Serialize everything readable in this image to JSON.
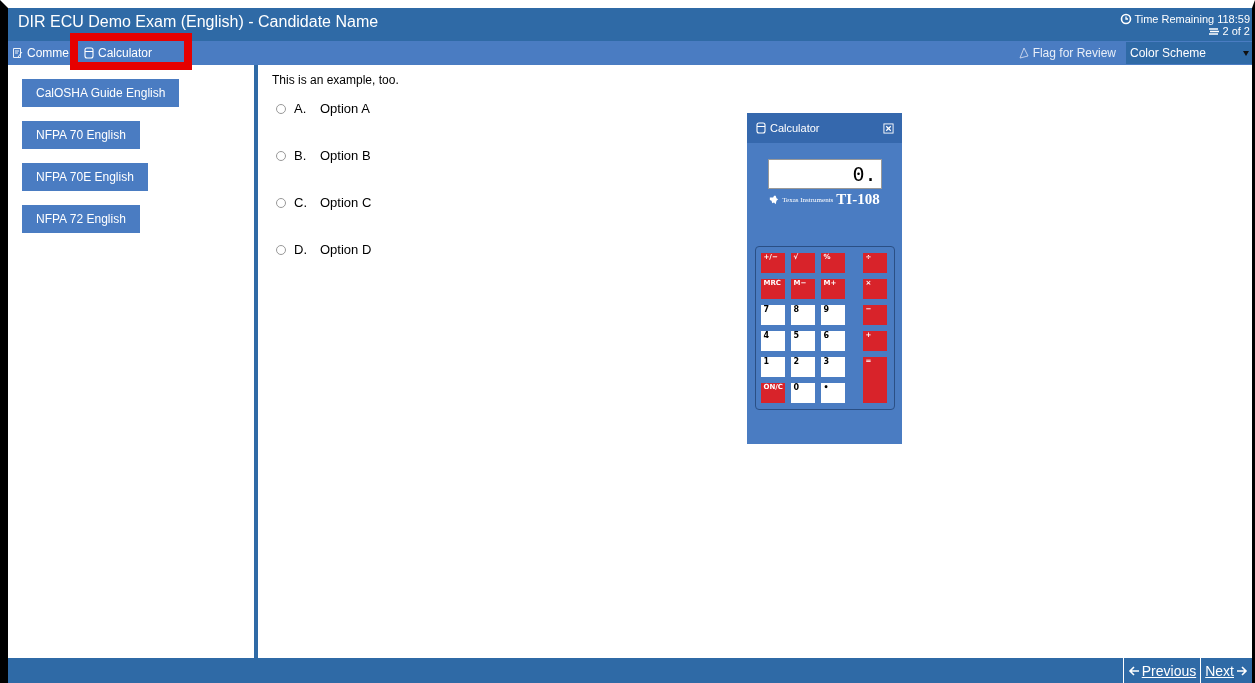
{
  "window": {
    "title": "DIR ECU Demo Exam (English) - Candidate Name"
  },
  "timer": "Time Remaining 118:59",
  "progress": "2 of 2",
  "toolbar": {
    "items": [
      {
        "label": "Comme",
        "kind": "comments"
      },
      {
        "label": "Calculator",
        "kind": "calculator"
      }
    ],
    "flag_label": "Flag for Review",
    "color_scheme": "Color Scheme"
  },
  "references": [
    "CalOSHA Guide English",
    "NFPA 70 English",
    "NFPA 70E English",
    "NFPA 72 English"
  ],
  "question": {
    "text": "This is an example, too.",
    "options": [
      {
        "letter": "A.",
        "text": "Option A",
        "selected": false
      },
      {
        "letter": "B.",
        "text": "Option B",
        "selected": false
      },
      {
        "letter": "C.",
        "text": "Option C",
        "selected": false
      },
      {
        "letter": "D.",
        "text": "Option D",
        "selected": false
      }
    ]
  },
  "calculator": {
    "title": "Calculator",
    "display": "0.",
    "brand": "Texas Instruments",
    "model": "TI-108",
    "keys": [
      {
        "label": "+/−",
        "kind": "function"
      },
      {
        "label": "√",
        "kind": "function"
      },
      {
        "label": "%",
        "kind": "function"
      },
      {
        "label": "÷",
        "kind": "function"
      },
      {
        "label": "MRC",
        "kind": "function"
      },
      {
        "label": "M−",
        "kind": "function"
      },
      {
        "label": "M+",
        "kind": "function"
      },
      {
        "label": "×",
        "kind": "function"
      },
      {
        "label": "7",
        "kind": "number"
      },
      {
        "label": "8",
        "kind": "number"
      },
      {
        "label": "9",
        "kind": "number"
      },
      {
        "label": "−",
        "kind": "function"
      },
      {
        "label": "4",
        "kind": "number"
      },
      {
        "label": "5",
        "kind": "number"
      },
      {
        "label": "6",
        "kind": "number"
      },
      {
        "label": "+",
        "kind": "function"
      },
      {
        "label": "1",
        "kind": "number"
      },
      {
        "label": "2",
        "kind": "number"
      },
      {
        "label": "3",
        "kind": "number"
      },
      {
        "label": "=",
        "kind": "equals"
      },
      {
        "label": "ON/C",
        "kind": "function"
      },
      {
        "label": "0",
        "kind": "number"
      },
      {
        "label": "•",
        "kind": "number"
      }
    ]
  },
  "nav": {
    "previous": "Previous",
    "next": "Next"
  }
}
